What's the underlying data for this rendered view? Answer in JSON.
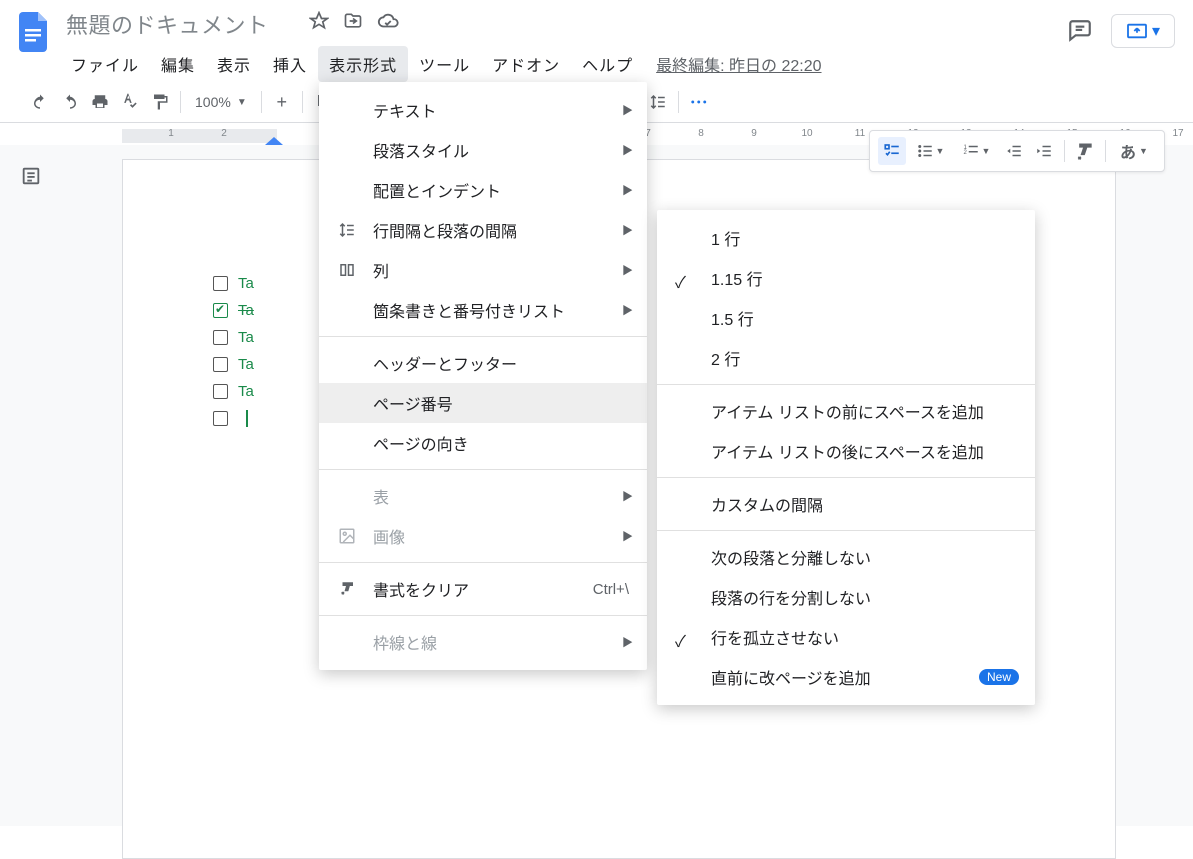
{
  "header": {
    "doc_title": "無題のドキュメント",
    "last_edit": "最終編集: 昨日の 22:20"
  },
  "menubar": [
    "ファイル",
    "編集",
    "表示",
    "挿入",
    "表示形式",
    "ツール",
    "アドオン",
    "ヘルプ"
  ],
  "menubar_active_index": 4,
  "toolbar": {
    "zoom": "100%"
  },
  "menu_format": {
    "items": [
      {
        "label": "テキスト",
        "sub": true
      },
      {
        "label": "段落スタイル",
        "sub": true
      },
      {
        "label": "配置とインデント",
        "sub": true
      },
      {
        "label": "行間隔と段落の間隔",
        "sub": true,
        "icon": "line-spacing-icon"
      },
      {
        "label": "列",
        "sub": true,
        "icon": "columns-icon"
      },
      {
        "label": "箇条書きと番号付きリスト",
        "sub": true
      }
    ],
    "items2": [
      {
        "label": "ヘッダーとフッター"
      },
      {
        "label": "ページ番号",
        "hover": true
      },
      {
        "label": "ページの向き"
      }
    ],
    "items3": [
      {
        "label": "表",
        "sub": true,
        "dis": true
      },
      {
        "label": "画像",
        "sub": true,
        "dis": true,
        "icon": "image-icon"
      }
    ],
    "items4": [
      {
        "label": "書式をクリア",
        "short": "Ctrl+\\",
        "icon": "clear-format-icon"
      }
    ],
    "items5": [
      {
        "label": "枠線と線",
        "sub": true,
        "dis": true
      }
    ]
  },
  "submenu_spacing": {
    "group1": [
      {
        "label": "1 行"
      },
      {
        "label": "1.15 行",
        "checked": true
      },
      {
        "label": "1.5 行"
      },
      {
        "label": "2 行"
      }
    ],
    "group2": [
      {
        "label": "アイテム リストの前にスペースを追加"
      },
      {
        "label": "アイテム リストの後にスペースを追加"
      }
    ],
    "group3": [
      {
        "label": "カスタムの間隔"
      }
    ],
    "group4": [
      {
        "label": "次の段落と分離しない"
      },
      {
        "label": "段落の行を分割しない"
      },
      {
        "label": "行を孤立させない",
        "checked": true
      },
      {
        "label": "直前に改ページを追加",
        "new": true
      }
    ],
    "new_label": "New"
  },
  "ruler": {
    "start": 2,
    "end": 18
  },
  "doc_content": {
    "tasks": [
      {
        "text": "Ta",
        "done": false
      },
      {
        "text": "Ta",
        "done": true
      },
      {
        "text": "Ta",
        "done": false
      },
      {
        "text": "Ta",
        "done": false
      },
      {
        "text": "Ta",
        "done": false
      }
    ]
  }
}
